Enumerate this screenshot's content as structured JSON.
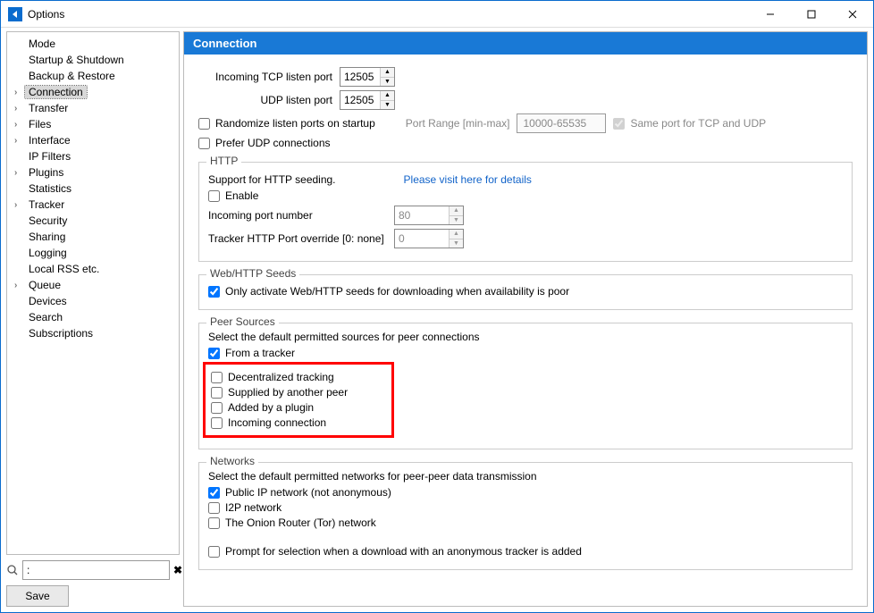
{
  "window": {
    "title": "Options"
  },
  "sidebar": {
    "items": [
      {
        "label": "Mode",
        "expandable": false
      },
      {
        "label": "Startup & Shutdown",
        "expandable": false
      },
      {
        "label": "Backup & Restore",
        "expandable": false
      },
      {
        "label": "Connection",
        "expandable": true,
        "selected": true
      },
      {
        "label": "Transfer",
        "expandable": true
      },
      {
        "label": "Files",
        "expandable": true
      },
      {
        "label": "Interface",
        "expandable": true
      },
      {
        "label": "IP Filters",
        "expandable": false
      },
      {
        "label": "Plugins",
        "expandable": true
      },
      {
        "label": "Statistics",
        "expandable": false
      },
      {
        "label": "Tracker",
        "expandable": true
      },
      {
        "label": "Security",
        "expandable": false
      },
      {
        "label": "Sharing",
        "expandable": false
      },
      {
        "label": "Logging",
        "expandable": false
      },
      {
        "label": "Local RSS etc.",
        "expandable": false
      },
      {
        "label": "Queue",
        "expandable": true
      },
      {
        "label": "Devices",
        "expandable": false
      },
      {
        "label": "Search",
        "expandable": false
      },
      {
        "label": "Subscriptions",
        "expandable": false
      }
    ],
    "search_value": ":",
    "save_label": "Save"
  },
  "panel": {
    "title": "Connection",
    "ports": {
      "tcp_label": "Incoming TCP listen port",
      "tcp_value": "12505",
      "udp_label": "UDP listen port",
      "udp_value": "12505"
    },
    "randomize": {
      "label": "Randomize listen ports on startup",
      "checked": false,
      "range_label": "Port Range [min-max]",
      "range_value": "10000-65535",
      "same_port_label": "Same port for TCP and UDP",
      "same_port_checked": true
    },
    "prefer_udp": {
      "label": "Prefer UDP connections",
      "checked": false
    },
    "http": {
      "legend": "HTTP",
      "support_text": "Support for HTTP seeding.",
      "link_text": "Please visit here for details",
      "enable_label": "Enable",
      "enable_checked": false,
      "incoming_label": "Incoming port number",
      "incoming_value": "80",
      "override_label": "Tracker HTTP Port override [0: none]",
      "override_value": "0"
    },
    "webseeds": {
      "legend": "Web/HTTP Seeds",
      "only_label": "Only activate Web/HTTP seeds for downloading when availability is poor",
      "only_checked": true
    },
    "peersources": {
      "legend": "Peer Sources",
      "desc": "Select the default permitted sources for peer connections",
      "items": [
        {
          "label": "From a tracker",
          "checked": true,
          "highlighted": false
        },
        {
          "label": "Decentralized tracking",
          "checked": false,
          "highlighted": true
        },
        {
          "label": "Supplied by another peer",
          "checked": false,
          "highlighted": true
        },
        {
          "label": "Added by a plugin",
          "checked": false,
          "highlighted": true
        },
        {
          "label": "Incoming connection",
          "checked": false,
          "highlighted": true
        }
      ]
    },
    "networks": {
      "legend": "Networks",
      "desc": "Select the default permitted networks for peer-peer data transmission",
      "items": [
        {
          "label": "Public IP network (not anonymous)",
          "checked": true
        },
        {
          "label": "I2P network",
          "checked": false
        },
        {
          "label": "The Onion Router (Tor) network",
          "checked": false
        }
      ],
      "prompt_label": "Prompt for selection when a download with an anonymous tracker is added",
      "prompt_checked": false
    }
  }
}
